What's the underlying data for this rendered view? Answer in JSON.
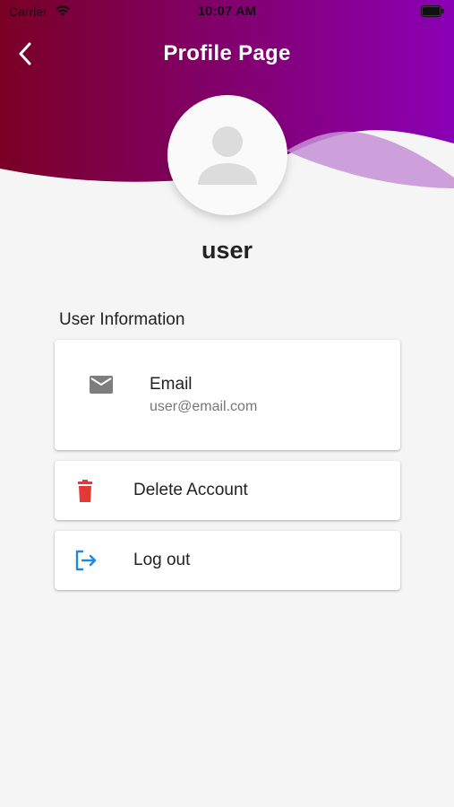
{
  "status_bar": {
    "carrier": "Carrier",
    "time": "10:07 AM",
    "wifi_icon": "wifi-icon",
    "battery_icon": "battery-icon"
  },
  "nav": {
    "back_icon": "chevron-left-icon",
    "title": "Profile Page"
  },
  "colors": {
    "header_gradient_start": "#7a0025",
    "header_gradient_end": "#8a00b5",
    "wave_light": "#c58fd6",
    "background": "#f5f5f5",
    "delete_red": "#e53935",
    "logout_blue": "#1e88e5",
    "email_icon_gray": "#7d7d7d"
  },
  "profile": {
    "avatar_icon": "person-icon",
    "username": "user"
  },
  "user_info": {
    "section_title": "User Information",
    "email": {
      "icon": "mail-icon",
      "label": "Email",
      "value": "user@email.com"
    }
  },
  "actions": {
    "delete": {
      "icon": "trash-icon",
      "label": "Delete Account"
    },
    "logout": {
      "icon": "logout-icon",
      "label": "Log out"
    }
  }
}
